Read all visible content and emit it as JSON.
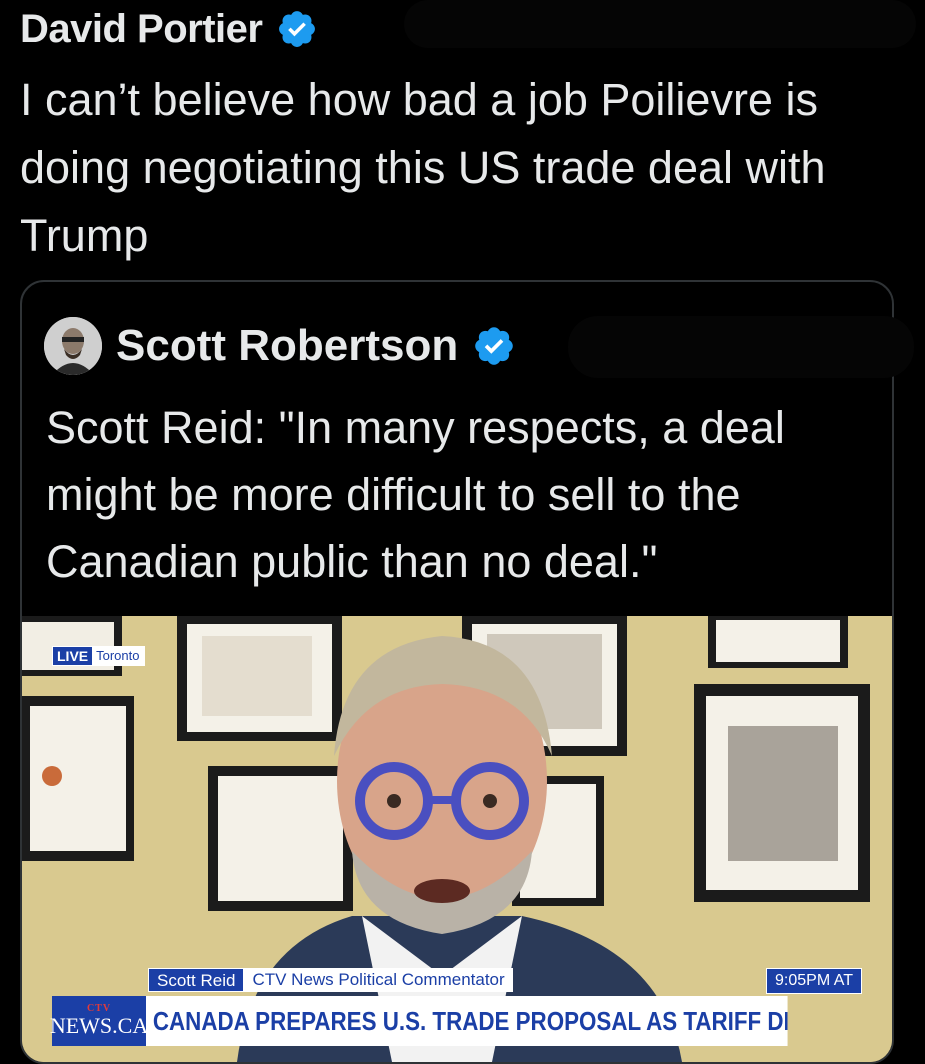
{
  "tweet": {
    "author_name": "David Portier",
    "verified": true,
    "text": "I can’t believe how bad a job Poilievre is doing negotiating this US trade deal with Trump"
  },
  "quoted_tweet": {
    "author_name": "Scott Robertson",
    "verified": true,
    "text": "Scott Reid: \"In many respects, a deal might be more difficult to sell to the Canadian public than no deal.\""
  },
  "video": {
    "live_label": "LIVE",
    "location": "Toronto",
    "lower_third_name": "Scott Reid",
    "lower_third_title": "CTV News Political Commentator",
    "time": "9:05PM AT",
    "logo_top": "CTV",
    "logo_main": "NEWS.CA",
    "headline": "CANADA PREPARES U.S. TRADE PROPOSAL AS TARIFF DEADLINE LOOMS"
  },
  "colors": {
    "background": "#000000",
    "text": "#e7e9ea",
    "verified_blue": "#1d9bf0",
    "ctv_blue": "#1b3fa6"
  },
  "icons": {
    "verified": "verified-badge-icon",
    "avatar": "avatar"
  }
}
